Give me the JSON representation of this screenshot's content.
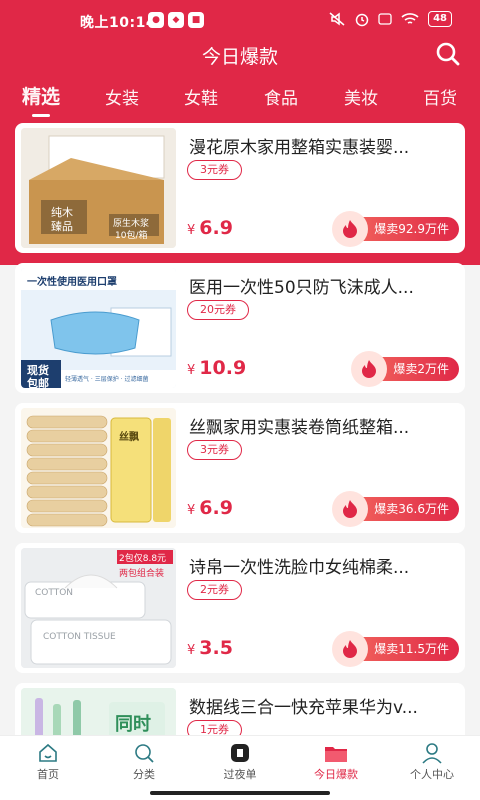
{
  "status": {
    "time": "晚上10:14",
    "battery": "48"
  },
  "header": {
    "title": "今日爆款"
  },
  "tabs": [
    {
      "label": "精选",
      "active": true
    },
    {
      "label": "女装",
      "active": false
    },
    {
      "label": "女鞋",
      "active": false
    },
    {
      "label": "食品",
      "active": false
    },
    {
      "label": "美妆",
      "active": false
    },
    {
      "label": "百货",
      "active": false
    }
  ],
  "products": [
    {
      "name": "漫花原木家用整箱实惠装婴...",
      "coupon": "3元券",
      "currency": "¥",
      "price": "6.9",
      "hot": "爆卖92.9万件",
      "thumb_text": [
        "纯木",
        "臻品",
        "原生木浆",
        "10包/箱"
      ]
    },
    {
      "name": "医用一次性50只防飞沫成人...",
      "coupon": "20元券",
      "currency": "¥",
      "price": "10.9",
      "hot": "爆卖2万件",
      "thumb_text": [
        "一次性使用医用口罩",
        "现货",
        "包邮",
        "轻薄透气 · 三层保护 · 过滤细菌"
      ]
    },
    {
      "name": "丝飘家用实惠装卷筒纸整箱...",
      "coupon": "3元券",
      "currency": "¥",
      "price": "6.9",
      "hot": "爆卖36.6万件",
      "thumb_text": [
        "丝飘"
      ]
    },
    {
      "name": "诗帛一次性洗脸巾女纯棉柔...",
      "coupon": "2元券",
      "currency": "¥",
      "price": "3.5",
      "hot": "爆卖11.5万件",
      "thumb_text": [
        "2包仅8.8元",
        "两包组合装",
        "COTTON",
        "COTTON TISSUE"
      ]
    },
    {
      "name": "数据线三合一快充苹果华为v...",
      "coupon": "1元券",
      "currency": "",
      "price": "",
      "hot": "",
      "thumb_text": [
        "同时"
      ]
    }
  ],
  "bottom_nav": [
    {
      "label": "首页",
      "icon": "home-icon",
      "active": false
    },
    {
      "label": "分类",
      "icon": "search-icon",
      "active": false
    },
    {
      "label": "过夜单",
      "icon": "overnight-icon",
      "active": false
    },
    {
      "label": "今日爆款",
      "icon": "folder-icon",
      "active": true
    },
    {
      "label": "个人中心",
      "icon": "user-icon",
      "active": false
    }
  ],
  "colors": {
    "brand": "#e02847",
    "background": "#f4f4f4"
  }
}
